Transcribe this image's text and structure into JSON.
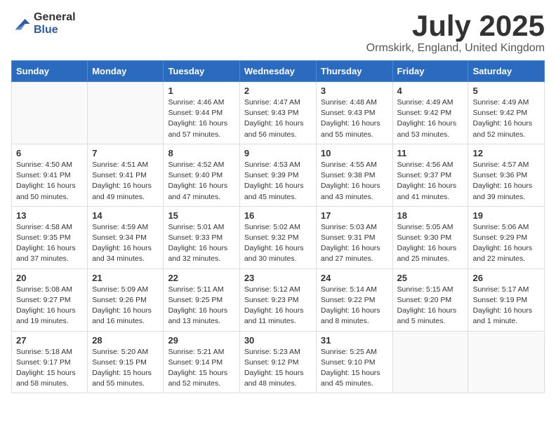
{
  "logo": {
    "general": "General",
    "blue": "Blue"
  },
  "title": "July 2025",
  "subtitle": "Ormskirk, England, United Kingdom",
  "days_of_week": [
    "Sunday",
    "Monday",
    "Tuesday",
    "Wednesday",
    "Thursday",
    "Friday",
    "Saturday"
  ],
  "weeks": [
    [
      {
        "day": "",
        "info": ""
      },
      {
        "day": "",
        "info": ""
      },
      {
        "day": "1",
        "info": "Sunrise: 4:46 AM\nSunset: 9:44 PM\nDaylight: 16 hours and 57 minutes."
      },
      {
        "day": "2",
        "info": "Sunrise: 4:47 AM\nSunset: 9:43 PM\nDaylight: 16 hours and 56 minutes."
      },
      {
        "day": "3",
        "info": "Sunrise: 4:48 AM\nSunset: 9:43 PM\nDaylight: 16 hours and 55 minutes."
      },
      {
        "day": "4",
        "info": "Sunrise: 4:49 AM\nSunset: 9:42 PM\nDaylight: 16 hours and 53 minutes."
      },
      {
        "day": "5",
        "info": "Sunrise: 4:49 AM\nSunset: 9:42 PM\nDaylight: 16 hours and 52 minutes."
      }
    ],
    [
      {
        "day": "6",
        "info": "Sunrise: 4:50 AM\nSunset: 9:41 PM\nDaylight: 16 hours and 50 minutes."
      },
      {
        "day": "7",
        "info": "Sunrise: 4:51 AM\nSunset: 9:41 PM\nDaylight: 16 hours and 49 minutes."
      },
      {
        "day": "8",
        "info": "Sunrise: 4:52 AM\nSunset: 9:40 PM\nDaylight: 16 hours and 47 minutes."
      },
      {
        "day": "9",
        "info": "Sunrise: 4:53 AM\nSunset: 9:39 PM\nDaylight: 16 hours and 45 minutes."
      },
      {
        "day": "10",
        "info": "Sunrise: 4:55 AM\nSunset: 9:38 PM\nDaylight: 16 hours and 43 minutes."
      },
      {
        "day": "11",
        "info": "Sunrise: 4:56 AM\nSunset: 9:37 PM\nDaylight: 16 hours and 41 minutes."
      },
      {
        "day": "12",
        "info": "Sunrise: 4:57 AM\nSunset: 9:36 PM\nDaylight: 16 hours and 39 minutes."
      }
    ],
    [
      {
        "day": "13",
        "info": "Sunrise: 4:58 AM\nSunset: 9:35 PM\nDaylight: 16 hours and 37 minutes."
      },
      {
        "day": "14",
        "info": "Sunrise: 4:59 AM\nSunset: 9:34 PM\nDaylight: 16 hours and 34 minutes."
      },
      {
        "day": "15",
        "info": "Sunrise: 5:01 AM\nSunset: 9:33 PM\nDaylight: 16 hours and 32 minutes."
      },
      {
        "day": "16",
        "info": "Sunrise: 5:02 AM\nSunset: 9:32 PM\nDaylight: 16 hours and 30 minutes."
      },
      {
        "day": "17",
        "info": "Sunrise: 5:03 AM\nSunset: 9:31 PM\nDaylight: 16 hours and 27 minutes."
      },
      {
        "day": "18",
        "info": "Sunrise: 5:05 AM\nSunset: 9:30 PM\nDaylight: 16 hours and 25 minutes."
      },
      {
        "day": "19",
        "info": "Sunrise: 5:06 AM\nSunset: 9:29 PM\nDaylight: 16 hours and 22 minutes."
      }
    ],
    [
      {
        "day": "20",
        "info": "Sunrise: 5:08 AM\nSunset: 9:27 PM\nDaylight: 16 hours and 19 minutes."
      },
      {
        "day": "21",
        "info": "Sunrise: 5:09 AM\nSunset: 9:26 PM\nDaylight: 16 hours and 16 minutes."
      },
      {
        "day": "22",
        "info": "Sunrise: 5:11 AM\nSunset: 9:25 PM\nDaylight: 16 hours and 13 minutes."
      },
      {
        "day": "23",
        "info": "Sunrise: 5:12 AM\nSunset: 9:23 PM\nDaylight: 16 hours and 11 minutes."
      },
      {
        "day": "24",
        "info": "Sunrise: 5:14 AM\nSunset: 9:22 PM\nDaylight: 16 hours and 8 minutes."
      },
      {
        "day": "25",
        "info": "Sunrise: 5:15 AM\nSunset: 9:20 PM\nDaylight: 16 hours and 5 minutes."
      },
      {
        "day": "26",
        "info": "Sunrise: 5:17 AM\nSunset: 9:19 PM\nDaylight: 16 hours and 1 minute."
      }
    ],
    [
      {
        "day": "27",
        "info": "Sunrise: 5:18 AM\nSunset: 9:17 PM\nDaylight: 15 hours and 58 minutes."
      },
      {
        "day": "28",
        "info": "Sunrise: 5:20 AM\nSunset: 9:15 PM\nDaylight: 15 hours and 55 minutes."
      },
      {
        "day": "29",
        "info": "Sunrise: 5:21 AM\nSunset: 9:14 PM\nDaylight: 15 hours and 52 minutes."
      },
      {
        "day": "30",
        "info": "Sunrise: 5:23 AM\nSunset: 9:12 PM\nDaylight: 15 hours and 48 minutes."
      },
      {
        "day": "31",
        "info": "Sunrise: 5:25 AM\nSunset: 9:10 PM\nDaylight: 15 hours and 45 minutes."
      },
      {
        "day": "",
        "info": ""
      },
      {
        "day": "",
        "info": ""
      }
    ]
  ]
}
